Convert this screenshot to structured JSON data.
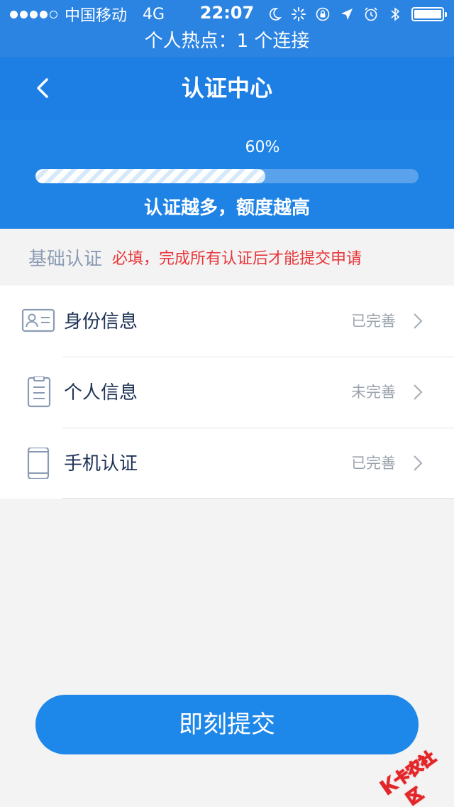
{
  "status_bar": {
    "carrier": "中国移动",
    "network": "4G",
    "time": "22:07"
  },
  "hotspot_banner": "个人热点：1 个连接",
  "header": {
    "title": "认证中心"
  },
  "progress": {
    "percent_text": "60%",
    "fraction": 0.6,
    "slogan": "认证越多，额度越高"
  },
  "section": {
    "title": "基础认证",
    "note": "必填，完成所有认证后才能提交申请"
  },
  "items": [
    {
      "label": "身份信息",
      "status": "已完善",
      "icon": "id-card-icon"
    },
    {
      "label": "个人信息",
      "status": "未完善",
      "icon": "document-icon"
    },
    {
      "label": "手机认证",
      "status": "已完善",
      "icon": "phone-icon"
    }
  ],
  "submit": {
    "label": "即刻提交"
  },
  "watermark": {
    "text": "卡农社区"
  },
  "colors": {
    "header_blue": "#1d7ee4",
    "accent_blue": "#1e87ea",
    "warning_red": "#e8363a",
    "icon_gray": "#8a9bb3"
  }
}
